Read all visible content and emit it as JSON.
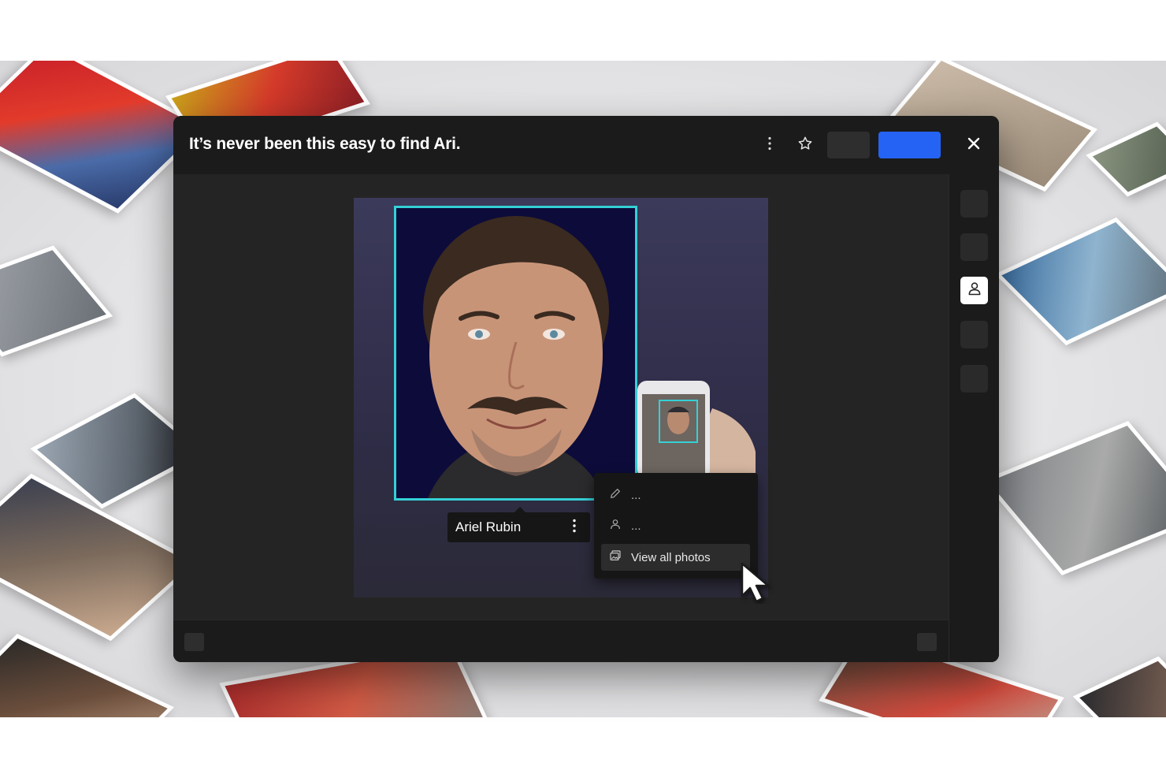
{
  "modal": {
    "title": "It’s never been this easy to find Ari."
  },
  "icons": {
    "more": "more-vertical-icon",
    "star": "star-icon",
    "close": "close-icon",
    "person": "person-icon",
    "pencil": "pencil-icon",
    "gallery": "gallery-icon"
  },
  "colors": {
    "accent_blue": "#2563f5",
    "face_highlight": "#34d1d6",
    "modal_bg": "#1b1b1b",
    "content_bg": "#242424"
  },
  "face_tag": {
    "name": "Ariel Rubin"
  },
  "context_menu": {
    "items": [
      {
        "label": "...",
        "icon": "pencil-icon"
      },
      {
        "label": "...",
        "icon": "person-icon"
      },
      {
        "label": "View all photos",
        "icon": "gallery-icon",
        "active": true
      }
    ]
  }
}
